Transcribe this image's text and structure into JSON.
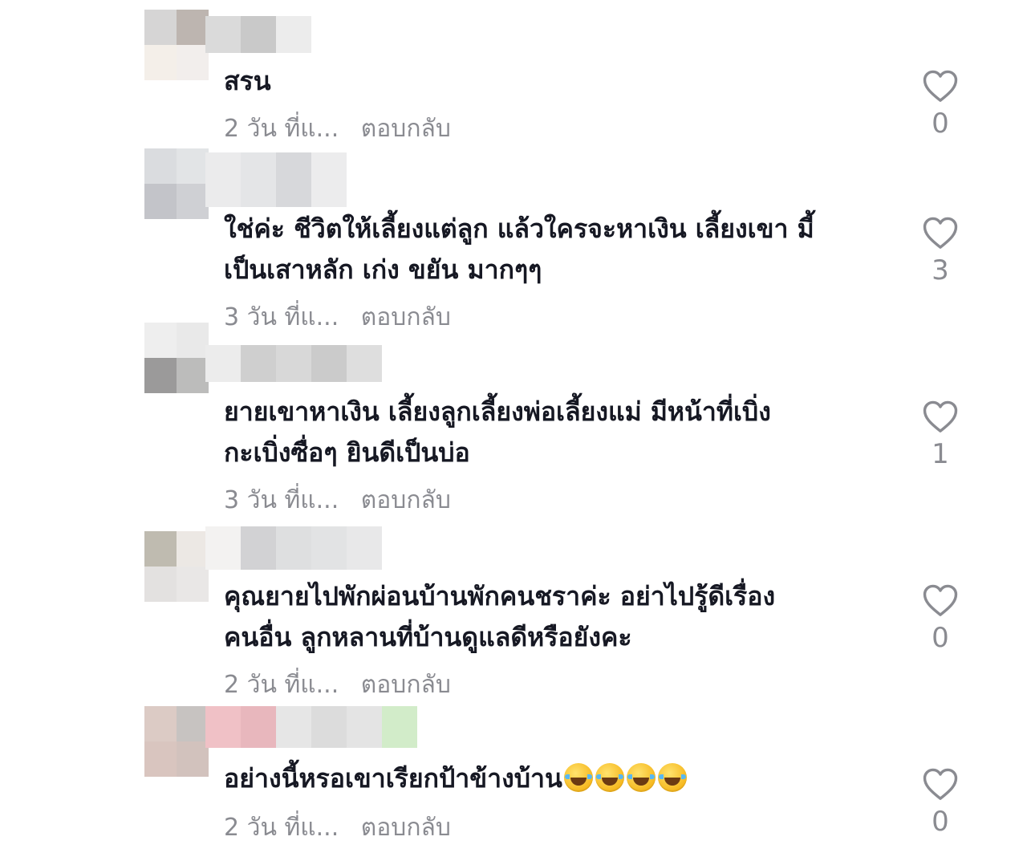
{
  "comments": [
    {
      "text": "สรน",
      "time": "2 วัน ที่แ...",
      "reply_label": "ตอบกลับ",
      "like_count": "0",
      "emojis": 0
    },
    {
      "text": "ใช่ค่ะ ชีวิตให้เลี้ยงแต่ลูก แล้วใครจะหาเงิน เลี้ยงเขา มี้\nเป็นเสาหลัก เก่ง ขยัน มากๆๆ",
      "time": "3 วัน ที่แ...",
      "reply_label": "ตอบกลับ",
      "like_count": "3",
      "emojis": 0
    },
    {
      "text": "ยายเขาหาเงิน เลี้ยงลูกเลี้ยงพ่อเลี้ยงแม่ มีหน้าที่เบิ่ง\nกะเบิ่งซื่อๆ ยินดีเป็นบ่อ",
      "time": "3 วัน ที่แ...",
      "reply_label": "ตอบกลับ",
      "like_count": "1",
      "emojis": 0
    },
    {
      "text": "คุณยายไปพักผ่อนบ้านพักคนชราค่ะ อย่าไปรู้ดีเรื่อง\nคนอื่น ลูกหลานที่บ้านดูแลดีหรือยังคะ",
      "time": "2 วัน ที่แ...",
      "reply_label": "ตอบกลับ",
      "like_count": "0",
      "emojis": 0
    },
    {
      "text": "อย่างนี้หรอเขาเรียกป้าข้างบ้าน",
      "time": "2 วัน ที่แ...",
      "reply_label": "ตอบกลับ",
      "like_count": "0",
      "emojis": 4,
      "emoji_name": "face-with-tears-of-joy-icon"
    }
  ],
  "colors": {
    "text": "#161823",
    "secondary": "#8a8b91",
    "background": "#ffffff"
  },
  "icons": {
    "like": "heart-outline-icon"
  }
}
